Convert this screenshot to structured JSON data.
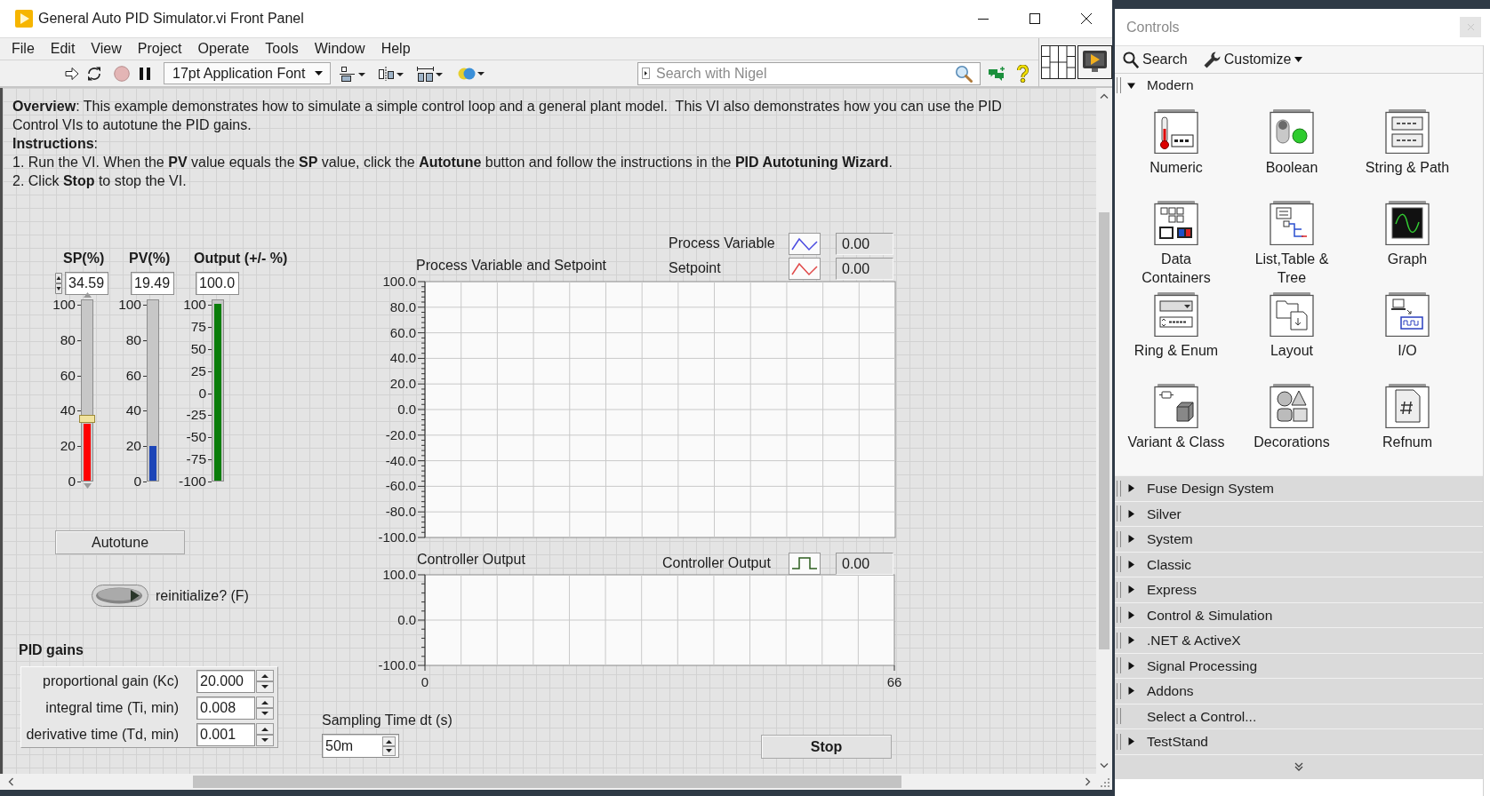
{
  "window": {
    "title": "General Auto PID Simulator.vi Front Panel"
  },
  "menu": [
    "File",
    "Edit",
    "View",
    "Project",
    "Operate",
    "Tools",
    "Window",
    "Help"
  ],
  "toolbar": {
    "font": "17pt Application Font",
    "search": {
      "placeholder": "Search with Nigel"
    }
  },
  "panel": {
    "overview": "**Overview**: This example demonstrates how to simulate a simple control loop and a general plant model.  This VI also demonstrates how you can use the PID Control VIs to autotune the PID gains.",
    "instructions_title": "**Instructions**:",
    "steps": [
      "1. Run the VI. When the **PV** value equals the **SP** value, click the **Autotune** button and follow the instructions in the **PID Autotuning Wizard**.",
      "2. Click **Stop** to stop the VI."
    ],
    "gauges": [
      {
        "kind": "control",
        "label": "SP(%)",
        "value": "34.59",
        "level": 0.3459,
        "color": "#ff0000",
        "scale": [
          "100",
          "80",
          "60",
          "40",
          "20",
          "0"
        ]
      },
      {
        "kind": "indicator",
        "label": "PV(%)",
        "value": "19.49",
        "level": 0.1949,
        "color": "#1c45b8",
        "scale": [
          "100",
          "80",
          "60",
          "40",
          "20",
          "0"
        ]
      },
      {
        "kind": "indicator",
        "label": "Output (+/- %)",
        "value": "100.0",
        "level": 1,
        "color": "#0a7d0a",
        "scale": [
          "100",
          "75",
          "50",
          "25",
          "0",
          "-25",
          "-50",
          "-75",
          "-100"
        ]
      }
    ],
    "autotune_button": "Autotune",
    "reinitialize": {
      "label": "reinitialize? (F)",
      "on": false
    },
    "pid_gains": {
      "title": "PID gains",
      "fields": [
        {
          "label": "proportional gain (Kc)",
          "value": "20.000"
        },
        {
          "label": "integral time (Ti, min)",
          "value": "0.008"
        },
        {
          "label": "derivative time (Td, min)",
          "value": "0.001"
        }
      ]
    },
    "charts": [
      {
        "title": "Process Variable and Setpoint",
        "step_plot": false,
        "readings": [
          "0.00",
          "0.00"
        ],
        "chart_data": {
          "type": "line",
          "grid": true,
          "ylim": [
            -100,
            100
          ],
          "yticks": [
            {
              "value": 100,
              "label": "100.0"
            },
            {
              "value": 80,
              "label": "80.0"
            },
            {
              "value": 60,
              "label": "60.0"
            },
            {
              "value": 40,
              "label": "40.0"
            },
            {
              "value": 20,
              "label": "20.0"
            },
            {
              "value": 0,
              "label": "0.0"
            },
            {
              "value": -20,
              "label": "-20.0"
            },
            {
              "value": -40,
              "label": "-40.0"
            },
            {
              "value": -60,
              "label": "-60.0"
            },
            {
              "value": -80,
              "label": "-80.0"
            },
            {
              "value": -100,
              "label": "-100.0"
            }
          ],
          "series": [
            {
              "name": "Process Variable",
              "color": "#4a4ae0"
            },
            {
              "name": "Setpoint",
              "color": "#e04848"
            }
          ]
        }
      },
      {
        "title": "Controller Output",
        "step_plot": true,
        "readings": [
          "0.00"
        ],
        "x_scale": [
          "0",
          "66"
        ],
        "chart_data": {
          "type": "line",
          "grid": true,
          "ylim": [
            -100,
            100
          ],
          "yticks": [
            {
              "value": 100,
              "label": "100.0"
            },
            {
              "value": 0,
              "label": "0.0"
            },
            {
              "value": -100,
              "label": "-100.0"
            }
          ],
          "series": [
            {
              "name": "Controller Output",
              "color": "#2d5e1e"
            }
          ]
        }
      }
    ],
    "sampling_time": {
      "label": "Sampling Time dt (s)",
      "value": "50m"
    },
    "stop_button": "Stop"
  },
  "palette": {
    "title": "Controls",
    "tools": [
      {
        "kind": "button",
        "label": "Search"
      },
      {
        "kind": "menu",
        "label": "Customize"
      }
    ],
    "sections": [
      {
        "kind": "category",
        "label": "Modern",
        "expanded": true,
        "items": [
          "Numeric",
          "Boolean",
          "String & Path",
          "Data Containers",
          "List,Table & Tree",
          "Graph",
          "Ring & Enum",
          "Layout",
          "I/O",
          "Variant & Class",
          "Decorations",
          "Refnum"
        ]
      },
      {
        "kind": "category",
        "label": "Fuse Design System",
        "expanded": false
      },
      {
        "kind": "category",
        "label": "Silver",
        "expanded": false
      },
      {
        "kind": "category",
        "label": "System",
        "expanded": false
      },
      {
        "kind": "category",
        "label": "Classic",
        "expanded": false
      },
      {
        "kind": "category",
        "label": "Express",
        "expanded": false
      },
      {
        "kind": "category",
        "label": "Control & Simulation",
        "expanded": false
      },
      {
        "kind": "category",
        "label": ".NET & ActiveX",
        "expanded": false
      },
      {
        "kind": "category",
        "label": "Signal Processing",
        "expanded": false
      },
      {
        "kind": "category",
        "label": "Addons",
        "expanded": false
      },
      {
        "kind": "action",
        "label": "Select a Control..."
      },
      {
        "kind": "category",
        "label": "TestStand",
        "expanded": false
      }
    ]
  }
}
